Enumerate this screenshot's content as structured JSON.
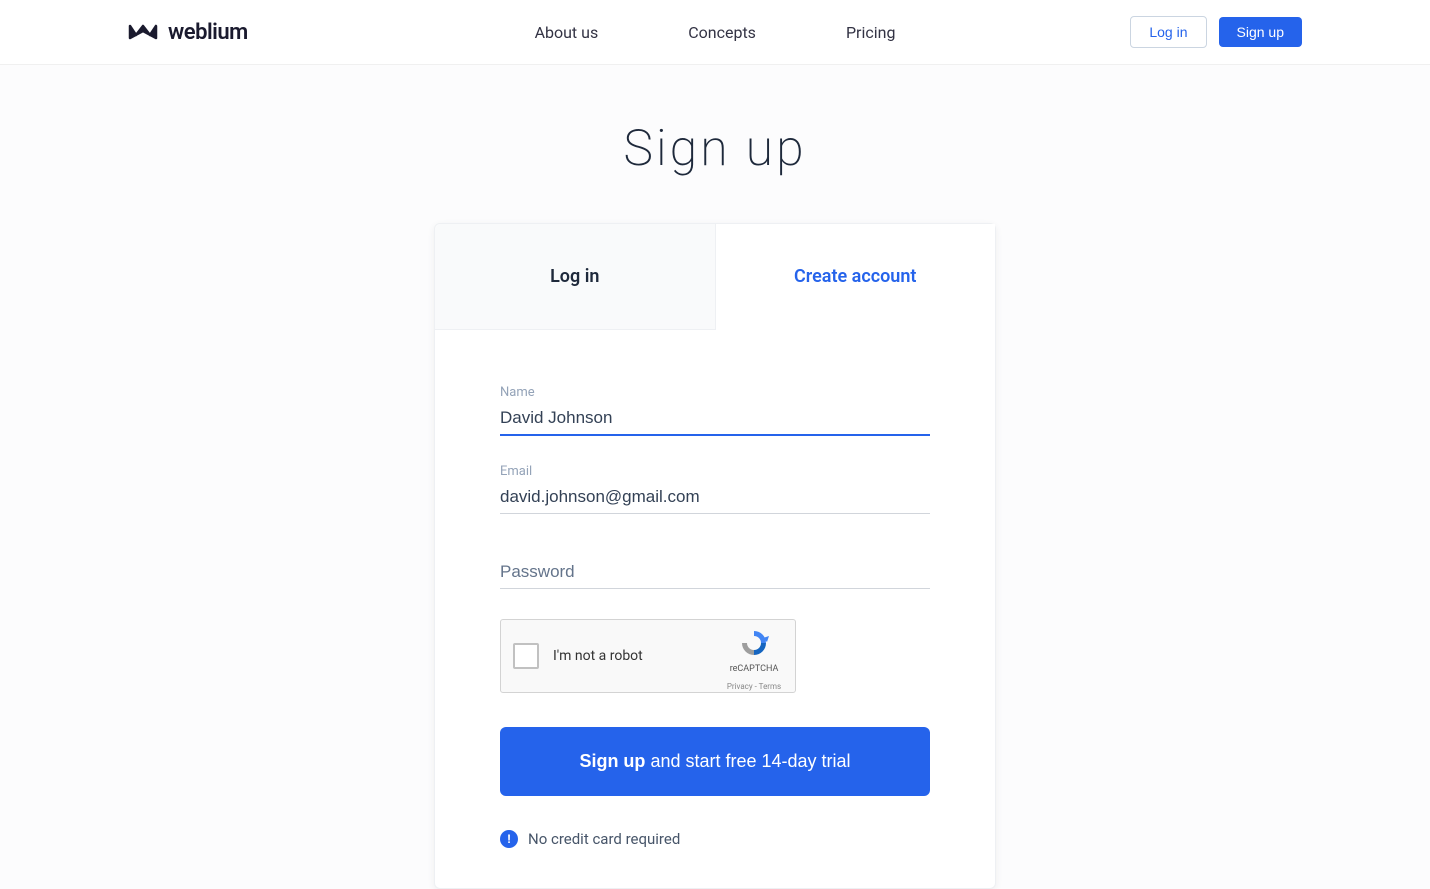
{
  "header": {
    "logo_text": "weblium",
    "nav": {
      "about": "About us",
      "concepts": "Concepts",
      "pricing": "Pricing"
    },
    "login_label": "Log in",
    "signup_label": "Sign up"
  },
  "page": {
    "title": "Sign up"
  },
  "tabs": {
    "login": "Log in",
    "create": "Create account"
  },
  "form": {
    "name_label": "Name",
    "name_value": "David Johnson",
    "email_label": "Email",
    "email_value": "david.johnson@gmail.com",
    "password_placeholder": "Password"
  },
  "recaptcha": {
    "label": "I'm not a robot",
    "brand": "reCAPTCHA",
    "links": "Privacy - Terms"
  },
  "submit": {
    "bold": "Sign up",
    "rest": " and start free 14-day trial"
  },
  "note": {
    "text": "No credit card required"
  }
}
